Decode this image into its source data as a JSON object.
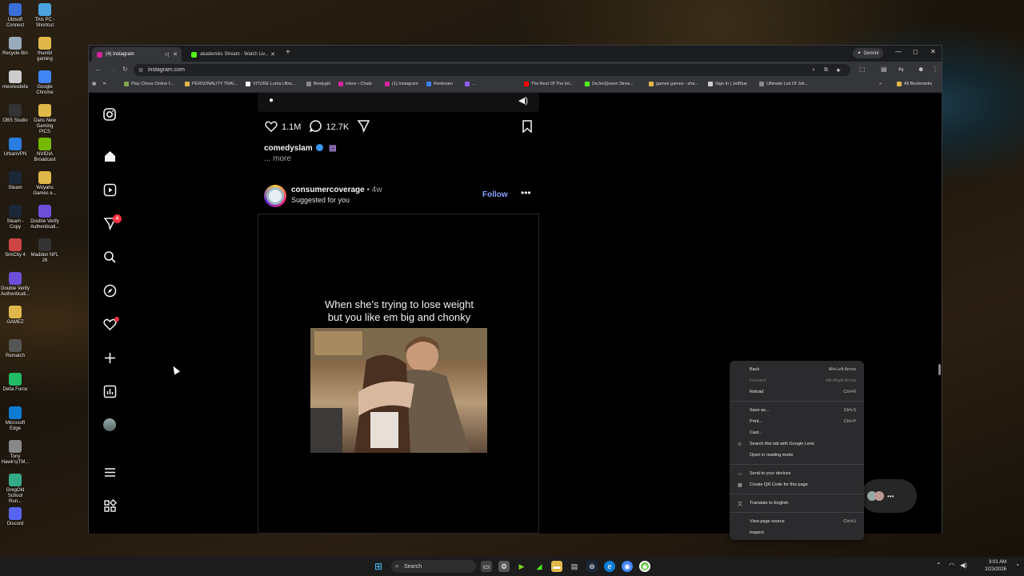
{
  "desktop": {
    "icons": [
      {
        "label": "Ubisoft Connect",
        "icon": "ubisoft-icon",
        "color": "#3a6fd8"
      },
      {
        "label": "This PC - Shortcut",
        "icon": "pc-icon",
        "color": "#4aa3df"
      },
      {
        "label": "Recycle Bin",
        "icon": "recycle-bin-icon",
        "color": "#9ab"
      },
      {
        "label": "thumbl gaming",
        "icon": "folder-icon",
        "color": "#e0b84a"
      },
      {
        "label": "meoresdefa",
        "icon": "file-icon",
        "color": "#ccc"
      },
      {
        "label": "Google Chrome",
        "icon": "chrome-icon",
        "color": "#4285f4"
      },
      {
        "label": "OBS Studio",
        "icon": "obs-icon",
        "color": "#333"
      },
      {
        "label": "Dans New Gaming PICS",
        "icon": "folder-icon",
        "color": "#e0b84a"
      },
      {
        "label": "UrbanVPN",
        "icon": "vpn-icon",
        "color": "#2a7de1"
      },
      {
        "label": "NVIDIA Broadcast",
        "icon": "nvidia-icon",
        "color": "#76b900"
      },
      {
        "label": "Steam",
        "icon": "steam-icon",
        "color": "#1b2838"
      },
      {
        "label": "Woyahs Games e...",
        "icon": "folder-icon",
        "color": "#e0b84a"
      },
      {
        "label": "Steam - Copy",
        "icon": "steam-icon",
        "color": "#1b2838"
      },
      {
        "label": "Double Verify Authenticati...",
        "icon": "app-icon",
        "color": "#6b4fd8"
      },
      {
        "label": "SimCity 4",
        "icon": "game-icon",
        "color": "#c44"
      },
      {
        "label": "Madden NFL 26",
        "icon": "game-icon",
        "color": "#333"
      },
      {
        "label": "Double Verify Authenticati...",
        "icon": "app-icon",
        "color": "#6b4fd8"
      },
      {
        "label": "GAMEZ",
        "icon": "folder-icon",
        "color": "#e0b84a"
      },
      {
        "label": "Rematch",
        "icon": "game-icon",
        "color": "#555"
      },
      {
        "label": "Delta Force",
        "icon": "game-icon",
        "color": "#2b6"
      },
      {
        "label": "Microsoft Edge",
        "icon": "edge-icon",
        "color": "#0c7cd5"
      },
      {
        "label": "Tony Hawk's(TM...",
        "icon": "game-icon",
        "color": "#888"
      },
      {
        "label": "GregOld School Run...",
        "icon": "game-icon",
        "color": "#3a8"
      },
      {
        "label": "Discord",
        "icon": "discord-icon",
        "color": "#5865f2"
      }
    ]
  },
  "browser": {
    "tabs": [
      {
        "label": "(4) Instagram",
        "active": true,
        "fav_color": "#d6249f"
      },
      {
        "label": "akademiks Stream - Watch Liv...",
        "active": false,
        "fav_color": "#53fc18"
      }
    ],
    "gemini_label": "Gemini",
    "url": "instagram.com",
    "bookmarks": [
      {
        "label": "Play Chess Online f...",
        "color": "#7fa650"
      },
      {
        "label": "PERSONALITY TRAI...",
        "color": "#e0b84a"
      },
      {
        "label": "VITURE Luma Ultra...",
        "color": "#fff"
      },
      {
        "label": "Bestygirl",
        "color": "#888"
      },
      {
        "label": "Inbox • Chats",
        "color": "#d6249f"
      },
      {
        "label": "(1) Instagram",
        "color": "#d6249f"
      },
      {
        "label": "Restream",
        "color": "#3b82f6"
      },
      {
        "label": "...",
        "color": "#8b5cf6"
      },
      {
        "label": "The Best Of The Int...",
        "color": "#ff0000"
      },
      {
        "label": "DeJenQueen Strea...",
        "color": "#53fc18"
      },
      {
        "label": "games games - sha...",
        "color": "#e0b84a"
      },
      {
        "label": "Sign In | JetBlue",
        "color": "#ccc"
      },
      {
        "label": "Ultimate List Of Jok...",
        "color": "#888"
      }
    ],
    "all_bookmarks_label": "All Bookmarks"
  },
  "instagram": {
    "sidebar_badge": "4",
    "prev_post": {
      "likes": "1.1M",
      "comments": "12.7K",
      "username": "comedyslam",
      "more_label": "... more"
    },
    "post": {
      "username": "consumercoverage",
      "age": "4w",
      "sep": "•",
      "subtitle": "Suggested for you",
      "follow_label": "Follow",
      "caption_line1": "When she's trying to lose weight",
      "caption_line2": "but you like em big and chonky"
    }
  },
  "context_menu": {
    "groups": [
      [
        {
          "label": "Back",
          "shortcut": "Alt+Left Arrow",
          "disabled": false
        },
        {
          "label": "Forward",
          "shortcut": "Alt+Right Arrow",
          "disabled": true
        },
        {
          "label": "Reload",
          "shortcut": "Ctrl+R",
          "disabled": false
        }
      ],
      [
        {
          "label": "Save as...",
          "shortcut": "Ctrl+S",
          "disabled": false
        },
        {
          "label": "Print...",
          "shortcut": "Ctrl+P",
          "disabled": false
        },
        {
          "label": "Cast...",
          "shortcut": "",
          "disabled": false
        },
        {
          "label": "Search this tab with Google Lens",
          "shortcut": "",
          "disabled": false,
          "icon": "lens-icon"
        },
        {
          "label": "Open in reading mode",
          "shortcut": "",
          "disabled": false
        }
      ],
      [
        {
          "label": "Send to your devices",
          "shortcut": "",
          "disabled": false,
          "icon": "devices-icon"
        },
        {
          "label": "Create QR Code for this page",
          "shortcut": "",
          "disabled": false,
          "icon": "qr-icon"
        }
      ],
      [
        {
          "label": "Translate to English",
          "shortcut": "",
          "disabled": false,
          "icon": "translate-icon"
        }
      ],
      [
        {
          "label": "View page source",
          "shortcut": "Ctrl+U",
          "disabled": false
        },
        {
          "label": "Inspect",
          "shortcut": "",
          "disabled": false
        }
      ]
    ]
  },
  "taskbar": {
    "search_label": "Search",
    "time": "3:01 AM",
    "date": "2/23/2026"
  }
}
